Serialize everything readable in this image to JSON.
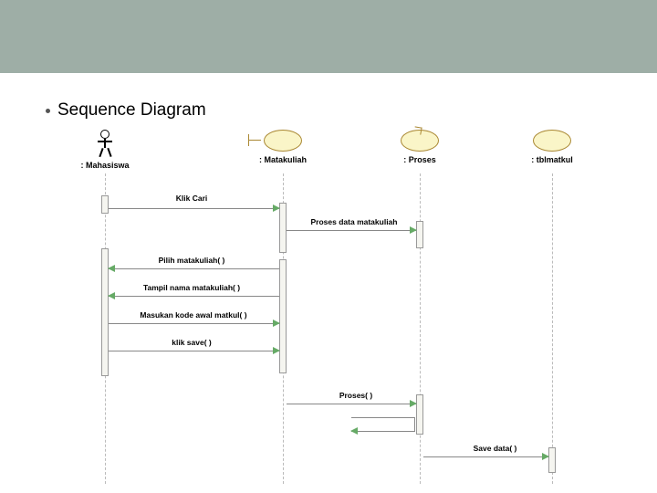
{
  "heading": "Sequence Diagram",
  "participants": {
    "actor": ": Mahasiswa",
    "boundary": ": Matakuliah",
    "control": ": Proses",
    "entity": ": tblmatkul"
  },
  "messages": {
    "m1": "Klik Cari",
    "m2": "Proses data matakuliah",
    "m3": "Pilih matakuliah( )",
    "m4": "Tampil nama matakuliah( )",
    "m5": "Masukan kode awal matkul( )",
    "m6": "klik save( )",
    "m7": "Proses( )",
    "m8": "Save data( )"
  }
}
